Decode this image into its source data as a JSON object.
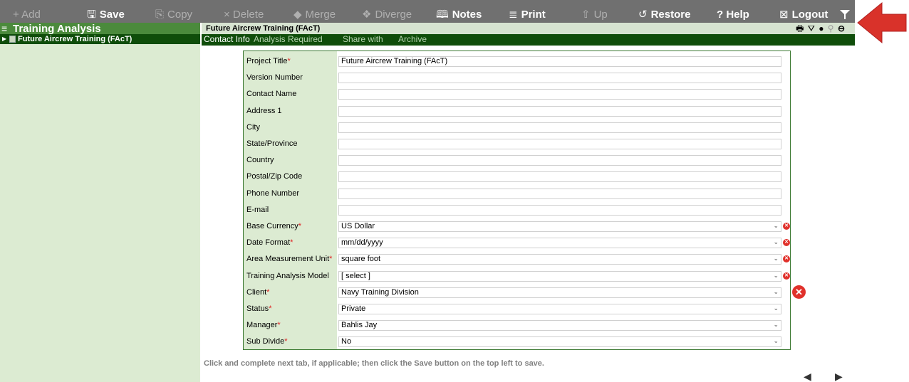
{
  "toolbar": {
    "add": "+ Add",
    "save": "Save",
    "copy": "Copy",
    "delete": "× Delete",
    "merge": "Merge",
    "diverge": "Diverge",
    "notes": "Notes",
    "print": "Print",
    "up": "Up",
    "restore": "Restore",
    "help": "? Help",
    "logout": "Logout"
  },
  "sidebar": {
    "title": "Training Analysis",
    "tree_item": "Future Aircrew Training (FAcT)"
  },
  "record": {
    "title": "Future Aircrew Training (FAcT)"
  },
  "tabs": [
    "Contact Info",
    "Analysis Required",
    "Share with",
    "Archive"
  ],
  "form": {
    "rows": [
      {
        "label": "Project Title",
        "required": "*",
        "value": "Future Aircrew Training (FAcT)"
      },
      {
        "label": "Version Number",
        "required": "",
        "value": ""
      },
      {
        "label": "Contact Name",
        "required": "",
        "value": ""
      },
      {
        "label": "Address 1",
        "required": "",
        "value": ""
      },
      {
        "label": "City",
        "required": "",
        "value": ""
      },
      {
        "label": "State/Province",
        "required": "",
        "value": ""
      },
      {
        "label": "Country",
        "required": "",
        "value": ""
      },
      {
        "label": "Postal/Zip Code",
        "required": "",
        "value": ""
      },
      {
        "label": "Phone Number",
        "required": "",
        "value": ""
      },
      {
        "label": "E-mail",
        "required": "",
        "value": ""
      },
      {
        "label": "Base Currency",
        "required": "*",
        "value": "US Dollar"
      },
      {
        "label": "Date Format",
        "required": "*",
        "value": "mm/dd/yyyy"
      },
      {
        "label": "Area Measurement Unit",
        "required": "*",
        "value": "square foot"
      },
      {
        "label": "Training Analysis Model",
        "required": "",
        "value": "[ select ]"
      },
      {
        "label": "Client",
        "required": "*",
        "value": "Navy Training Division"
      },
      {
        "label": "Status",
        "required": "*",
        "value": "Private"
      },
      {
        "label": "Manager",
        "required": "*",
        "value": "Bahlis Jay"
      },
      {
        "label": "Sub Divide",
        "required": "*",
        "value": "No"
      }
    ]
  },
  "hint": "Click and complete next tab, if applicable; then click the Save button on the top left to save.",
  "colors": {
    "toolbar": "#707070",
    "accent_green": "#4b8a3c",
    "dark_green": "#0f4d0a",
    "light_green": "#dcebd2",
    "required": "#e02020",
    "clear_red": "#e0312b",
    "annotation_arrow": "#d9322a"
  }
}
